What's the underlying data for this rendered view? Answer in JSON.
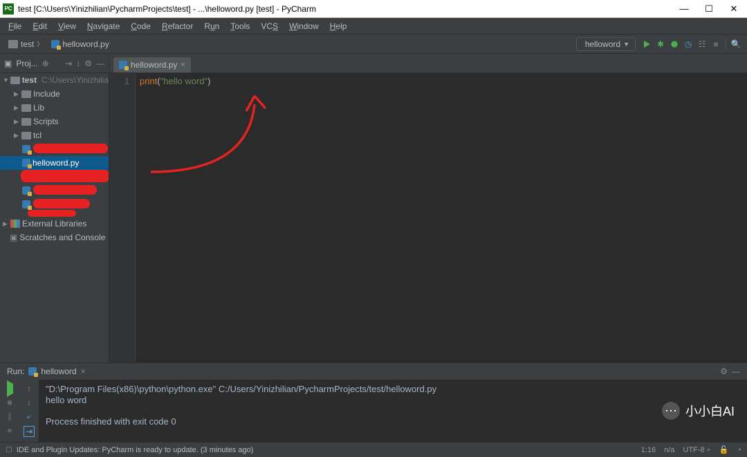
{
  "title": "test [C:\\Users\\Yinizhilian\\PycharmProjects\\test] - ...\\helloword.py [test] - PyCharm",
  "menu": [
    "File",
    "Edit",
    "View",
    "Navigate",
    "Code",
    "Refactor",
    "Run",
    "Tools",
    "VCS",
    "Window",
    "Help"
  ],
  "breadcrumb": {
    "project": "test",
    "file": "helloword.py"
  },
  "run_config": "helloword",
  "project_panel": {
    "title": "Proj..."
  },
  "tree": {
    "root": {
      "name": "test",
      "path": "C:\\Users\\Yinizhilia"
    },
    "folders": [
      "Include",
      "Lib",
      "Scripts",
      "tcl"
    ],
    "selected_file": "helloword.py",
    "external_libs": "External Libraries",
    "scratches": "Scratches and Console"
  },
  "editor": {
    "tab": "helloword.py",
    "line_no": "1",
    "code": {
      "fn": "print",
      "open": "(",
      "str": "\"hello word\"",
      "close": ")"
    }
  },
  "run": {
    "label": "Run:",
    "name": "helloword",
    "out1": "\"D:\\Program Files(x86)\\python\\python.exe\" C:/Users/Yinizhilian/PycharmProjects/test/helloword.py",
    "out2": "hello word",
    "out3": "Process finished with exit code 0"
  },
  "status": {
    "msg": "IDE and Plugin Updates: PyCharm is ready to update. (3 minutes ago)",
    "pos": "1:16",
    "na": "n/a",
    "enc": "UTF-8"
  },
  "badge": "小小白AI"
}
